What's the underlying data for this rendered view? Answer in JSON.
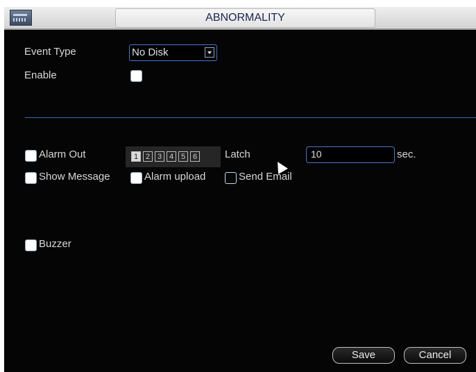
{
  "window": {
    "title": "ABNORMALITY"
  },
  "event_type": {
    "label": "Event Type",
    "selected": "No Disk"
  },
  "enable": {
    "label": "Enable",
    "checked": false
  },
  "alarm_out": {
    "label": "Alarm Out",
    "checked": false,
    "channels": [
      "1",
      "2",
      "3",
      "4",
      "5",
      "6"
    ],
    "selected_channel": "1"
  },
  "latch": {
    "label": "Latch",
    "value": "10",
    "unit": "sec."
  },
  "show_message": {
    "label": "Show Message",
    "checked": false
  },
  "alarm_upload": {
    "label": "Alarm upload",
    "checked": false
  },
  "send_email": {
    "label": "Send Email",
    "checked": false
  },
  "buzzer": {
    "label": "Buzzer",
    "checked": false
  },
  "buttons": {
    "save": "Save",
    "cancel": "Cancel"
  },
  "colors": {
    "background": "#050505",
    "accent": "#4b78c8",
    "title_text": "#1a2650"
  },
  "icons": {
    "title": "menu-panel-icon",
    "dropdown": "chevron-down-icon",
    "cursor": "mouse-pointer-icon"
  }
}
